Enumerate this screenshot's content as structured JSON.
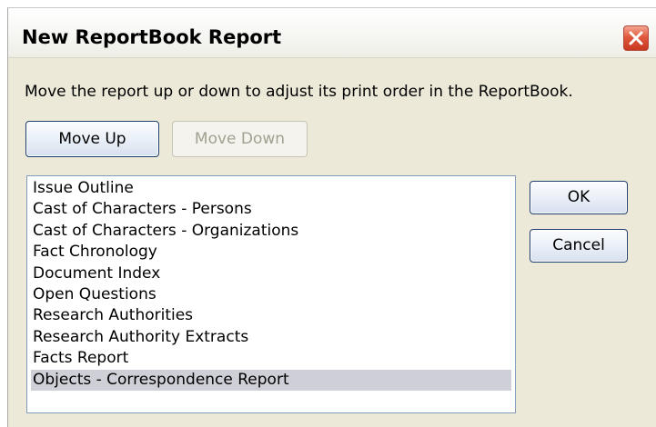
{
  "window": {
    "title": "New ReportBook Report"
  },
  "instruction": "Move the report up or down to adjust its print order in the ReportBook.",
  "buttons": {
    "move_up": "Move Up",
    "move_down": "Move Down",
    "ok": "OK",
    "cancel": "Cancel"
  },
  "reports": [
    "Issue Outline",
    "Cast of Characters - Persons",
    "Cast of Characters - Organizations",
    "Fact Chronology",
    "Document Index",
    "Open Questions",
    "Research Authorities",
    "Research Authority Extracts",
    "Facts Report",
    "Objects - Correspondence Report"
  ],
  "selected_report": "Objects - Correspondence Report",
  "colors": {
    "dialog_background": "#ece9d8",
    "selection": "#cfcfd8",
    "close_button": "#e0593f",
    "list_border": "#7f9db9"
  }
}
